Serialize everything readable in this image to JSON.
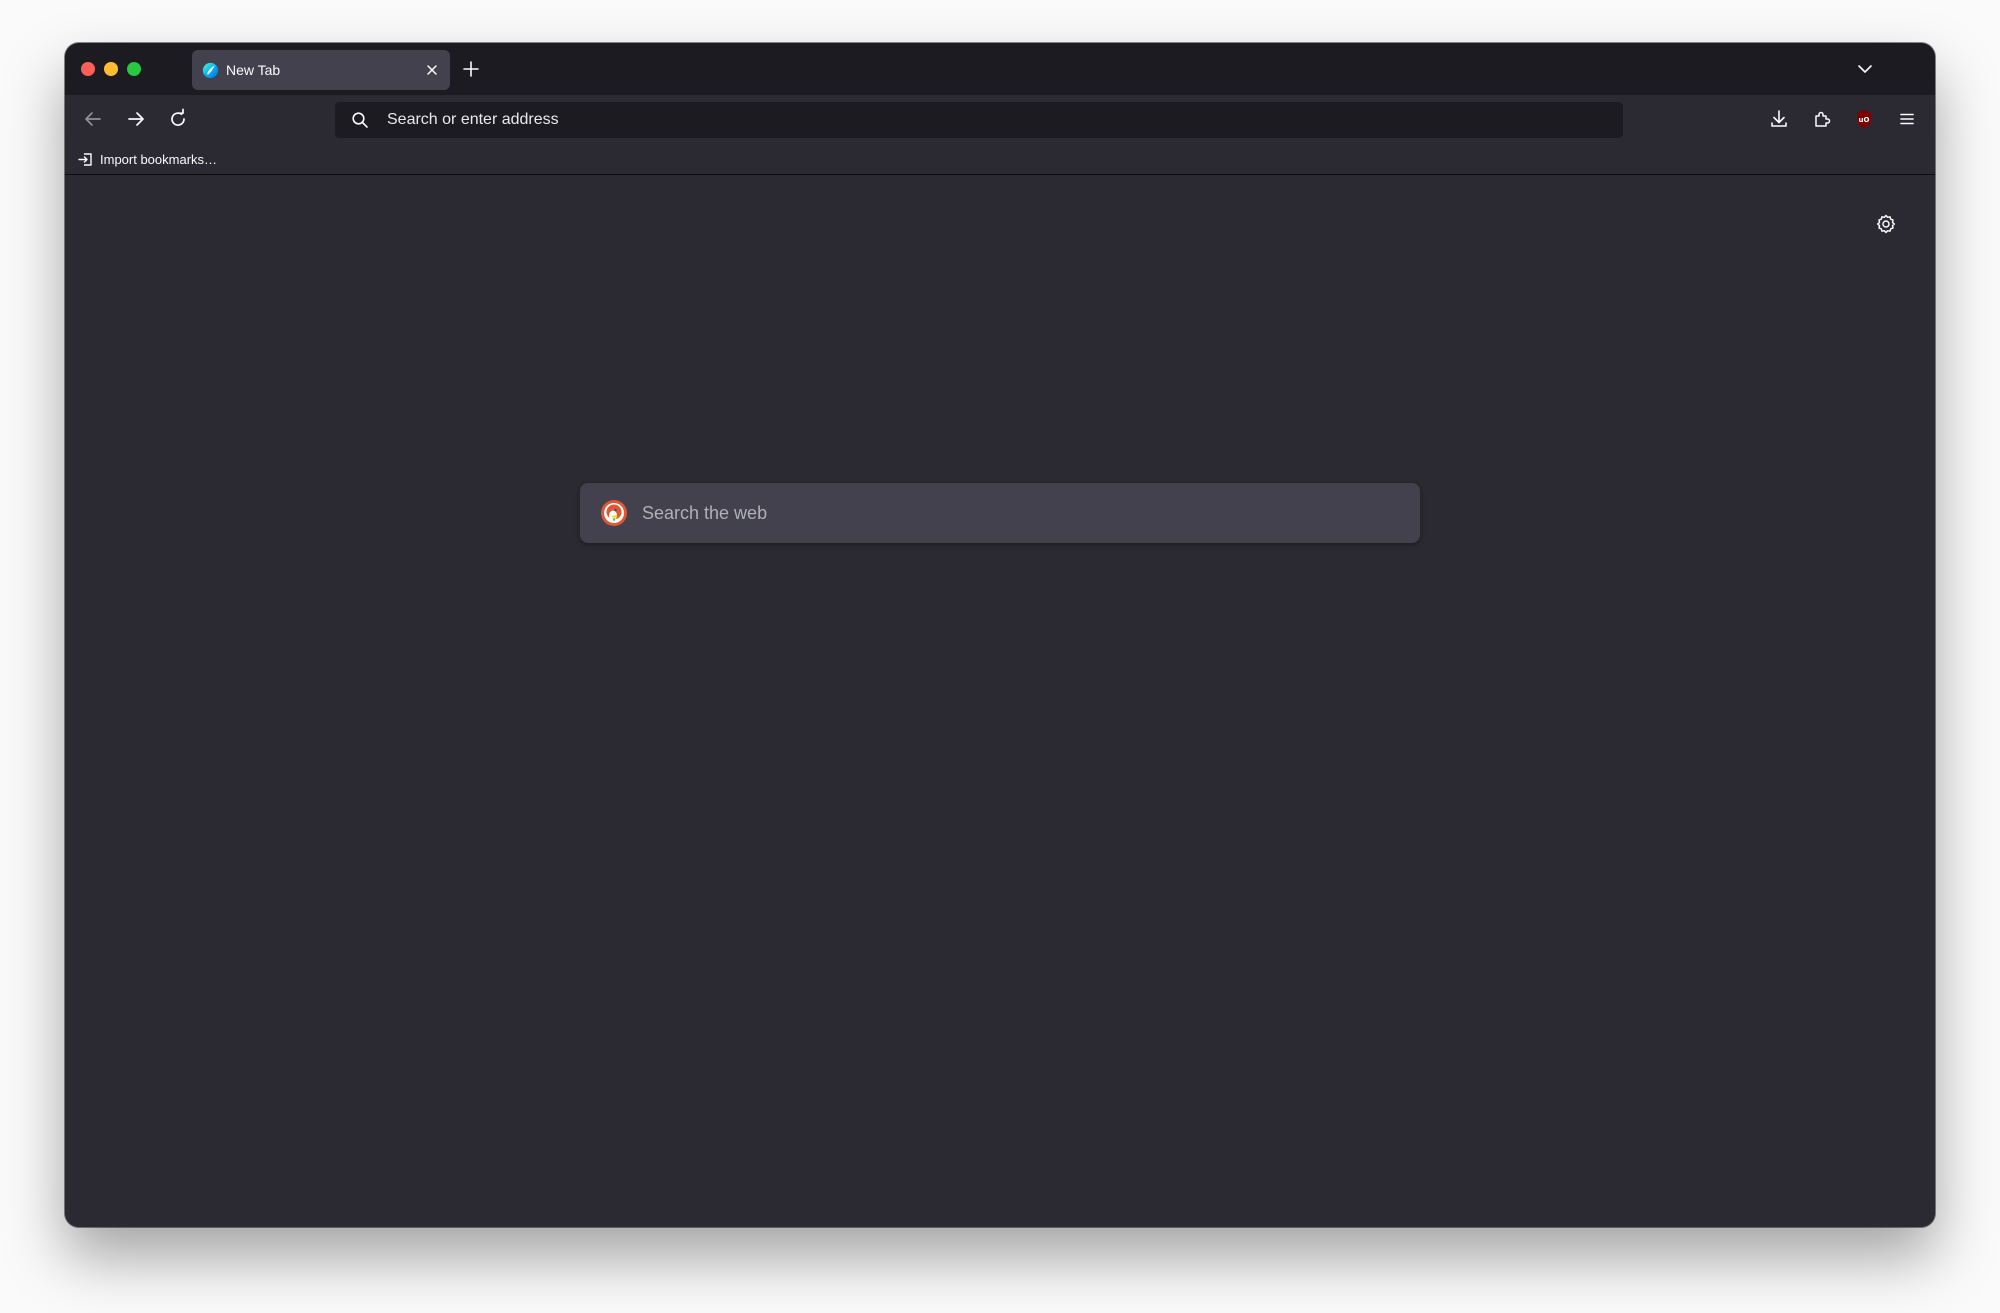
{
  "window": {
    "traffic_lights": [
      "close",
      "minimize",
      "zoom"
    ]
  },
  "tabs": [
    {
      "title": "New Tab",
      "active": true,
      "favicon": "firefox-icon"
    }
  ],
  "tabstrip": {
    "new_tab_icon": "plus-icon",
    "list_all_tabs_icon": "chevron-down-icon"
  },
  "toolbar": {
    "back_icon": "arrow-left-icon",
    "forward_icon": "arrow-right-icon",
    "reload_icon": "reload-icon",
    "url_placeholder": "Search or enter address",
    "downloads_icon": "download-icon",
    "extensions_icon": "puzzle-icon",
    "ublock_icon": "ublock-origin-icon",
    "menu_icon": "hamburger-menu-icon"
  },
  "bookmarks": {
    "items": [
      {
        "label": "Import bookmarks…",
        "icon": "import-icon"
      }
    ]
  },
  "newtab": {
    "search_placeholder": "Search the web",
    "search_engine_icon": "duckduckgo-icon",
    "settings_icon": "gear-icon"
  },
  "colors": {
    "tabstrip_bg": "#1c1b22",
    "toolbar_bg": "#2b2a33",
    "active_tab_bg": "#42414d",
    "search_box_bg": "#42414d",
    "text": "#fbfbfe",
    "ublock_red": "#800000"
  }
}
